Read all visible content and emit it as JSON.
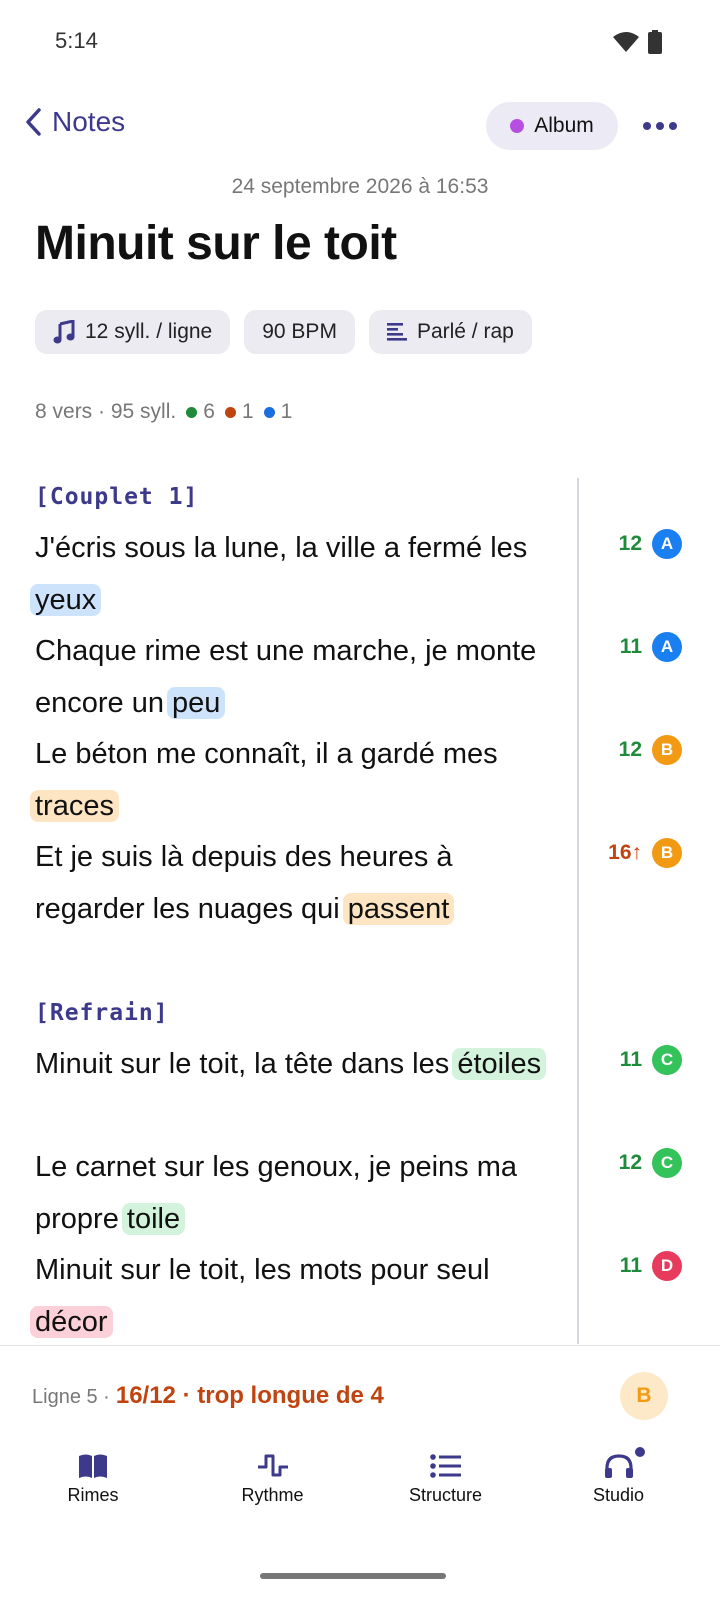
{
  "status": {
    "time": "5:14"
  },
  "header": {
    "back_label": "Notes",
    "album_label": "Album",
    "date": "24 septembre 2026 à 16:53",
    "title": "Minuit sur le toit"
  },
  "chips": [
    {
      "label": "12 syll. / ligne",
      "icon": "music-note-icon"
    },
    {
      "label": "90 BPM",
      "icon": ""
    },
    {
      "label": "Parlé / rap",
      "icon": "text-lines-icon"
    }
  ],
  "stats": {
    "summary": "8 vers · 95 syll.",
    "ok_count": "6",
    "ok_color": "#1f8a3b",
    "long_count": "1",
    "long_color": "#c0440f",
    "short_count": "1",
    "short_color": "#1a6fe0"
  },
  "colors": {
    "accent": "#3d3a8c",
    "rhyme_A": "#1a7ff0",
    "rhyme_A_bg": "#cde3fb",
    "rhyme_B": "#f39a14",
    "rhyme_B_bg": "#fde4c2",
    "rhyme_C": "#34c25a",
    "rhyme_C_bg": "#d3f3dc",
    "rhyme_D": "#e83a5c",
    "rhyme_D_bg": "#fbd0d8"
  },
  "sections": [
    {
      "label": "[Couplet 1]",
      "lines": [
        {
          "prefix": "J'écris sous la lune, la ville a fermé les ",
          "rhyme_word": "yeux",
          "syllables": "12",
          "rhyme": "A",
          "status": "ok"
        },
        {
          "prefix": "Chaque rime est une marche, je monte encore un ",
          "rhyme_word": "peu",
          "syllables": "11",
          "rhyme": "A",
          "status": "ok"
        },
        {
          "prefix": "Le béton me connaît, il a gardé mes ",
          "rhyme_word": "traces",
          "syllables": "12",
          "rhyme": "B",
          "status": "ok"
        },
        {
          "prefix": "Et je suis là depuis des heures à regarder les nuages qui ",
          "rhyme_word": "passent",
          "syllables": "16↑",
          "rhyme": "B",
          "status": "long"
        }
      ]
    },
    {
      "label": "[Refrain]",
      "lines": [
        {
          "prefix": "Minuit sur le toit, la tête dans les ",
          "rhyme_word": "étoiles",
          "syllables": "11",
          "rhyme": "C",
          "status": "ok"
        },
        {
          "prefix": "Le carnet sur les genoux, je peins ma propre ",
          "rhyme_word": "toile",
          "syllables": "12",
          "rhyme": "C",
          "status": "ok"
        },
        {
          "prefix": "Minuit sur le toit, les mots pour seul ",
          "rhyme_word": "décor",
          "syllables": "11",
          "rhyme": "D",
          "status": "ok"
        }
      ]
    }
  ],
  "bottom": {
    "line_label": "Ligne 5 ·",
    "warning": "16/12 · trop longue de 4",
    "rhyme": "B"
  },
  "nav": [
    {
      "label": "Rimes",
      "icon": "book-icon"
    },
    {
      "label": "Rythme",
      "icon": "rhythm-wave-icon"
    },
    {
      "label": "Structure",
      "icon": "list-icon"
    },
    {
      "label": "Studio",
      "icon": "headphones-icon"
    }
  ]
}
